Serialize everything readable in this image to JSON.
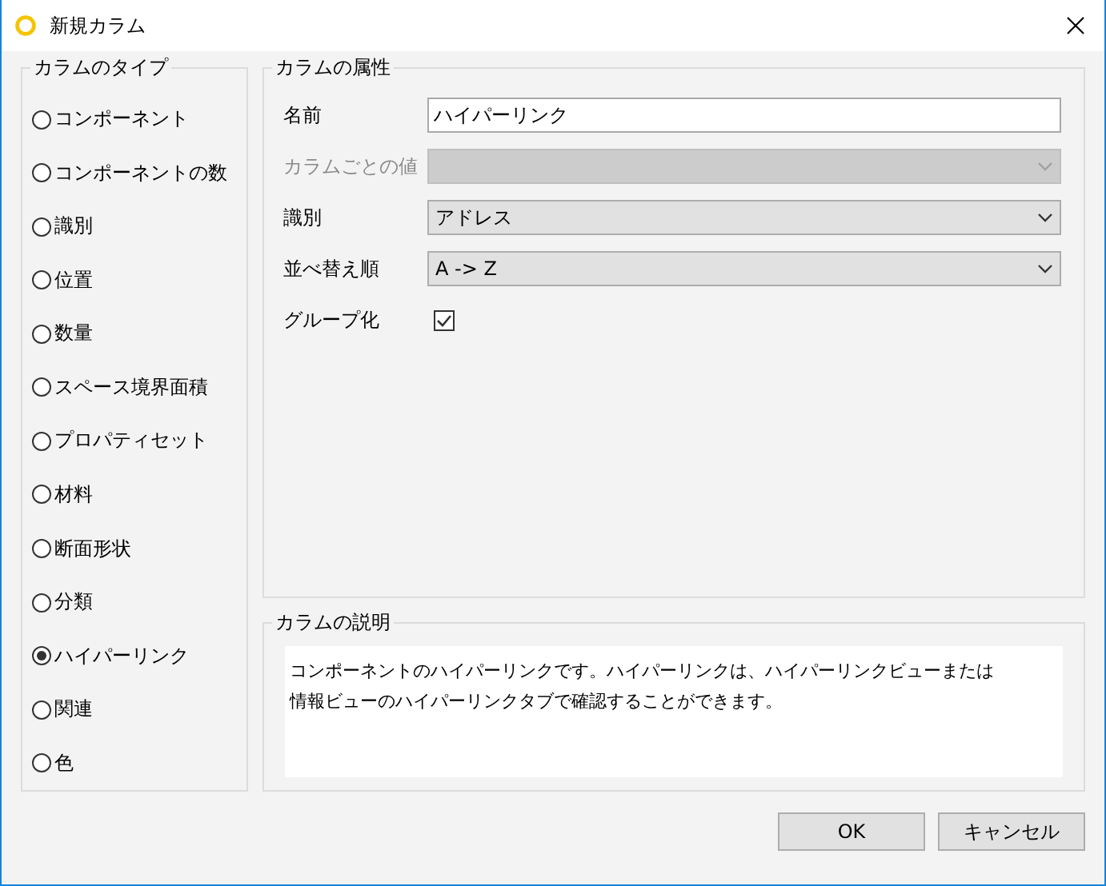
{
  "window": {
    "title": "新規カラム"
  },
  "column_type": {
    "title": "カラムのタイプ",
    "options": [
      {
        "label": "コンポーネント",
        "selected": false
      },
      {
        "label": "コンポーネントの数",
        "selected": false
      },
      {
        "label": "識別",
        "selected": false
      },
      {
        "label": "位置",
        "selected": false
      },
      {
        "label": "数量",
        "selected": false
      },
      {
        "label": "スペース境界面積",
        "selected": false
      },
      {
        "label": "プロパティセット",
        "selected": false
      },
      {
        "label": "材料",
        "selected": false
      },
      {
        "label": "断面形状",
        "selected": false
      },
      {
        "label": "分類",
        "selected": false
      },
      {
        "label": "ハイパーリンク",
        "selected": true
      },
      {
        "label": "関連",
        "selected": false
      },
      {
        "label": "色",
        "selected": false
      }
    ]
  },
  "attributes": {
    "title": "カラムの属性",
    "fields": [
      {
        "kind": "text",
        "label": "名前",
        "value": "ハイパーリンク",
        "disabled": false
      },
      {
        "kind": "combo",
        "label": "カラムごとの値",
        "disabled": true
      },
      {
        "kind": "combo",
        "label": "識別",
        "value": "アドレス",
        "disabled": false
      },
      {
        "kind": "combo",
        "label": "並べ替え順",
        "value": "A -> Z",
        "disabled": false
      },
      {
        "kind": "checkbox",
        "label": "グループ化",
        "checked": true,
        "disabled": false
      }
    ]
  },
  "description": {
    "title": "カラムの説明",
    "text": "コンポーネントのハイパーリンクです。ハイパーリンクは、ハイパーリンクビューまたは情報ビューのハイパーリンクタブで確認することができます。"
  },
  "buttons": [
    "OK",
    "キャンセル"
  ]
}
